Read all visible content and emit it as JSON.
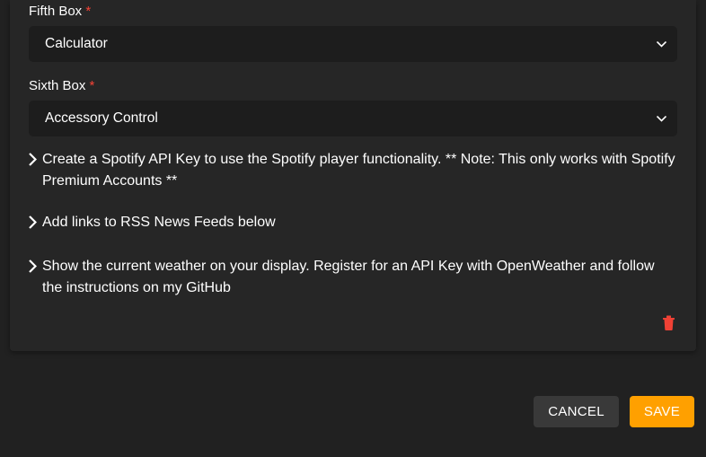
{
  "fields": {
    "fifth": {
      "label": "Fifth Box",
      "required_marker": "*",
      "value": "Calculator"
    },
    "sixth": {
      "label": "Sixth Box",
      "required_marker": "*",
      "value": "Accessory Control"
    }
  },
  "collapsibles": {
    "spotify": "Create a Spotify API Key to use the Spotify player functionality. ** Note: This only works with Spotify Premium Accounts **",
    "rss": "Add links to RSS News Feeds below",
    "weather": "Show the current weather on your display. Register for an API Key with OpenWeather and follow the instructions on my GitHub"
  },
  "footer": {
    "cancel": "CANCEL",
    "save": "SAVE"
  },
  "icons": {
    "trash": "trash-icon",
    "chevron": "chevron-right-icon",
    "caret": "caret-down-icon"
  }
}
